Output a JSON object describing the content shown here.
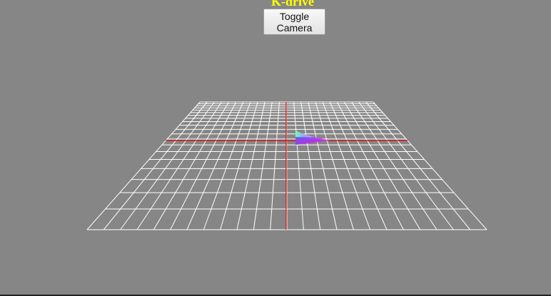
{
  "app": {
    "title": "K-drive"
  },
  "controls": {
    "toggle_camera_line1": "Toggle",
    "toggle_camera_line2": "Camera"
  },
  "scene": {
    "background_color": "#868686",
    "grid_color": "#ffffff",
    "axis_color": "#e00000",
    "title_color": "#ffff00",
    "grid_divisions": 24,
    "grid_rows": 20,
    "vehicle": "rainbow-triangle-car"
  }
}
